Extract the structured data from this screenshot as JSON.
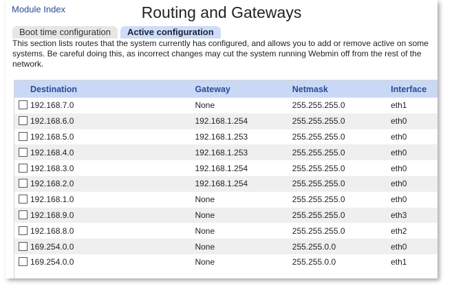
{
  "nav": {
    "module_index": "Module Index"
  },
  "page": {
    "title": "Routing and Gateways"
  },
  "tabs": [
    {
      "label": "Boot time configuration",
      "active": false
    },
    {
      "label": "Active configuration",
      "active": true
    }
  ],
  "description": "This section lists routes that the system currently has configured, and allows you to add or remove active on some systems. Be careful doing this, as incorrect changes may cut the system running Webmin off from the rest of the network.",
  "table": {
    "headers": [
      "Destination",
      "Gateway",
      "Netmask",
      "Interface"
    ],
    "rows": [
      {
        "destination": "192.168.7.0",
        "gateway": "None",
        "netmask": "255.255.255.0",
        "interface": "eth1"
      },
      {
        "destination": "192.168.6.0",
        "gateway": "192.168.1.254",
        "netmask": "255.255.255.0",
        "interface": "eth0"
      },
      {
        "destination": "192.168.5.0",
        "gateway": "192.168.1.253",
        "netmask": "255.255.255.0",
        "interface": "eth0"
      },
      {
        "destination": "192.168.4.0",
        "gateway": "192.168.1.253",
        "netmask": "255.255.255.0",
        "interface": "eth0"
      },
      {
        "destination": "192.168.3.0",
        "gateway": "192.168.1.254",
        "netmask": "255.255.255.0",
        "interface": "eth0"
      },
      {
        "destination": "192.168.2.0",
        "gateway": "192.168.1.254",
        "netmask": "255.255.255.0",
        "interface": "eth0"
      },
      {
        "destination": "192.168.1.0",
        "gateway": "None",
        "netmask": "255.255.255.0",
        "interface": "eth0"
      },
      {
        "destination": "192.168.9.0",
        "gateway": "None",
        "netmask": "255.255.255.0",
        "interface": "eth3"
      },
      {
        "destination": "192.168.8.0",
        "gateway": "None",
        "netmask": "255.255.255.0",
        "interface": "eth2"
      },
      {
        "destination": "169.254.0.0",
        "gateway": "None",
        "netmask": "255.255.0.0",
        "interface": "eth0"
      },
      {
        "destination": "169.254.0.0",
        "gateway": "None",
        "netmask": "255.255.0.0",
        "interface": "eth1"
      }
    ]
  },
  "colors": {
    "accent": "#2b4a9a",
    "header_bg": "#c9d9f5",
    "active_tab_bg": "#cfdcf7",
    "row_alt": "#efefef"
  }
}
